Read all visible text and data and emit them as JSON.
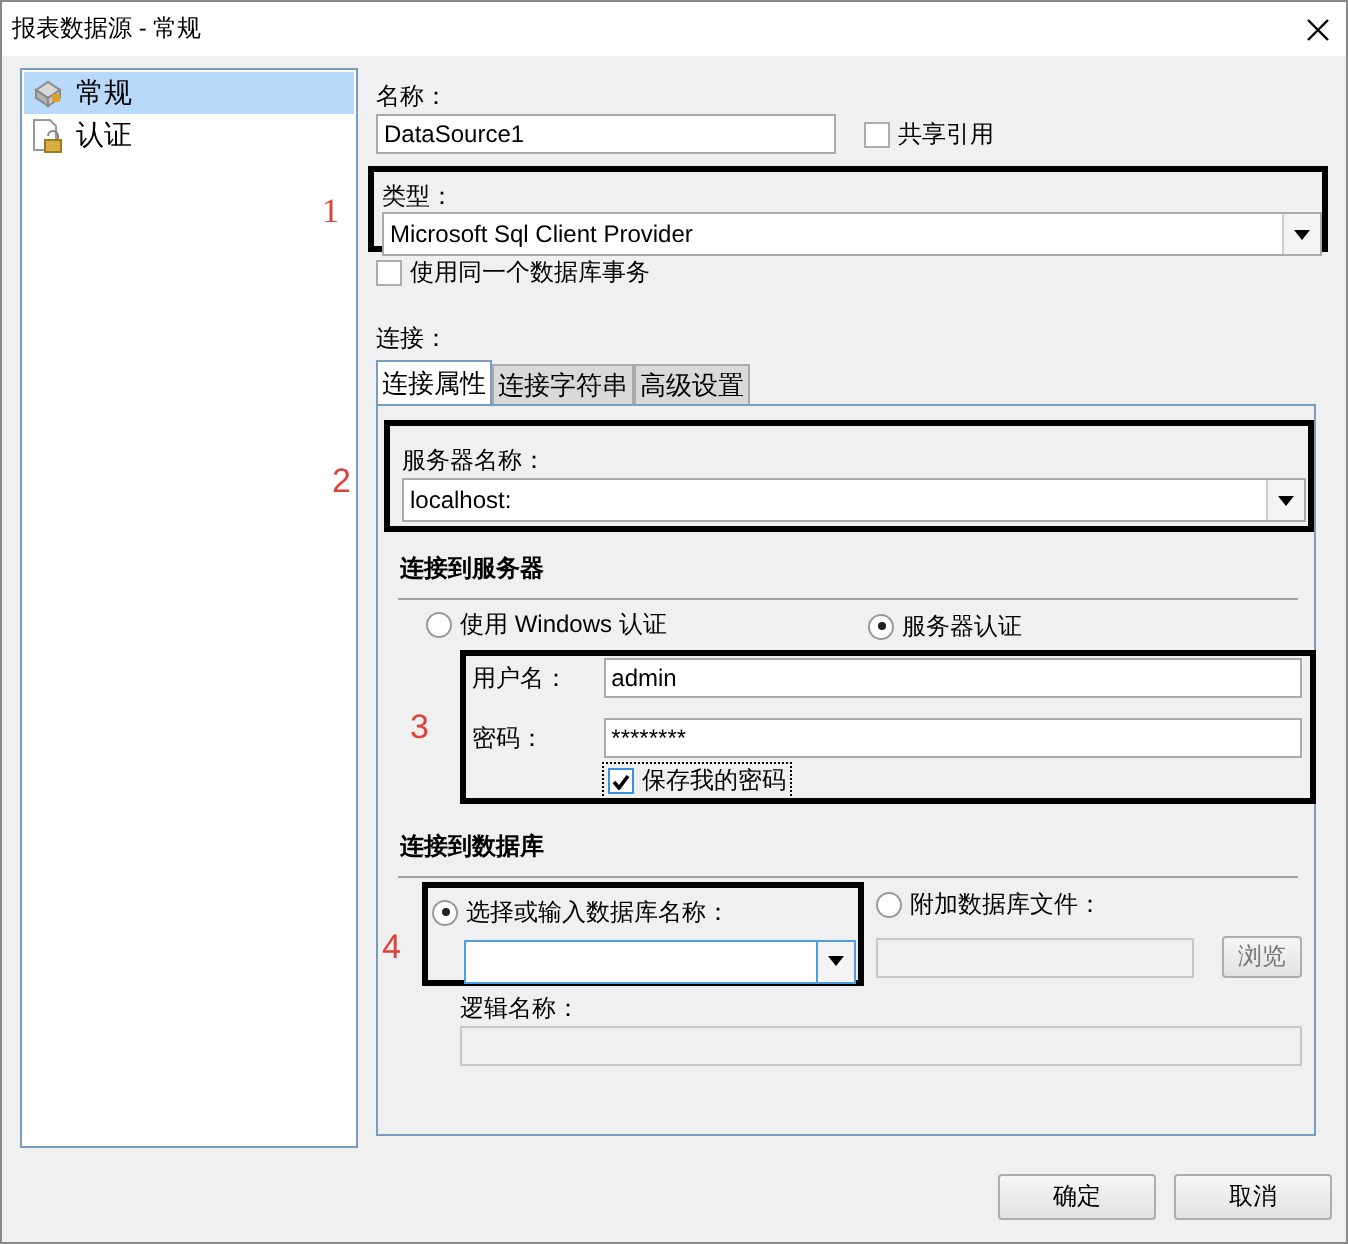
{
  "window": {
    "title": "报表数据源 - 常规"
  },
  "sidebar": {
    "items": [
      {
        "label": "常规",
        "kind": "general",
        "selected": true
      },
      {
        "label": "认证",
        "kind": "auth",
        "selected": false
      }
    ]
  },
  "name_field": {
    "label": "名称：",
    "value": "DataSource1"
  },
  "shared_reference": {
    "label": "共享引用",
    "checked": false
  },
  "type_field": {
    "annotation": "1",
    "label": "类型：",
    "value": "Microsoft Sql Client Provider"
  },
  "same_transaction": {
    "label": "使用同一个数据库事务",
    "checked": false
  },
  "connection": {
    "label": "连接：",
    "tabs": [
      {
        "label": "连接属性",
        "selected": true
      },
      {
        "label": "连接字符串",
        "selected": false
      },
      {
        "label": "高级设置",
        "selected": false
      }
    ],
    "server_name": {
      "annotation": "2",
      "label": "服务器名称：",
      "value": "localhost:"
    },
    "server_section": {
      "title": "连接到服务器",
      "auth_options": [
        {
          "label": "使用 Windows 认证",
          "selected": false
        },
        {
          "label": "服务器认证",
          "selected": true
        }
      ],
      "annotation": "3",
      "username": {
        "label": "用户名：",
        "value": "admin"
      },
      "password": {
        "label": "密码：",
        "value": "********"
      },
      "save_password": {
        "label": "保存我的密码",
        "checked": true
      }
    },
    "database_section": {
      "title": "连接到数据库",
      "annotation": "4",
      "options": [
        {
          "label": "选择或输入数据库名称：",
          "selected": true
        },
        {
          "label": "附加数据库文件：",
          "selected": false
        }
      ],
      "browse_button": "浏览",
      "logical_name": {
        "label": "逻辑名称："
      }
    }
  },
  "buttons": [
    "确定",
    "取消"
  ]
}
